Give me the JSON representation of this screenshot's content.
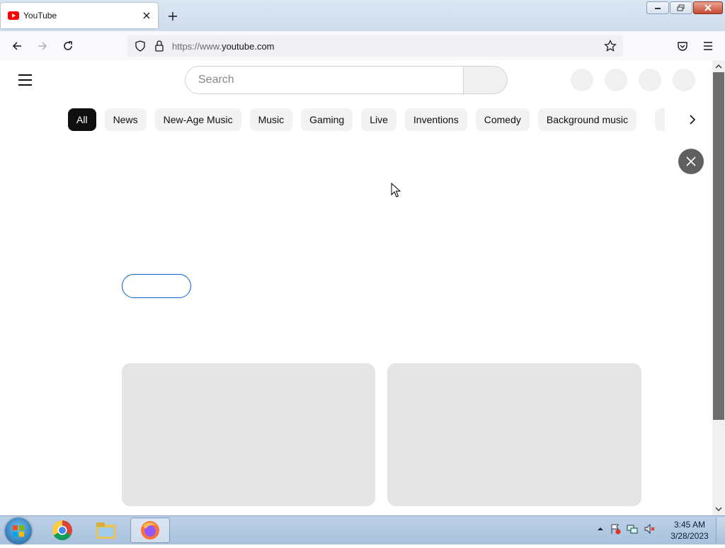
{
  "browser": {
    "tab": {
      "title": "YouTube",
      "favicon": "youtube-icon"
    },
    "new_tab_icon": "plus-icon",
    "url": {
      "prefix": "https://www.",
      "domain": "youtube.com"
    }
  },
  "youtube": {
    "search": {
      "placeholder": "Search"
    },
    "chips": [
      "All",
      "News",
      "New-Age Music",
      "Music",
      "Gaming",
      "Live",
      "Inventions",
      "Comedy",
      "Background music"
    ],
    "active_chip": "All"
  },
  "taskbar": {
    "apps": [
      "chrome-icon",
      "file-explorer-icon",
      "firefox-icon"
    ],
    "clock": {
      "time": "3:45 AM",
      "date": "3/28/2023"
    }
  },
  "colors": {
    "youtube_red": "#ff0000",
    "chip_bg": "#f2f2f2",
    "chip_active_bg": "#0f0f0f",
    "skeleton": "#e5e5e5",
    "link_blue": "#065fd4"
  }
}
